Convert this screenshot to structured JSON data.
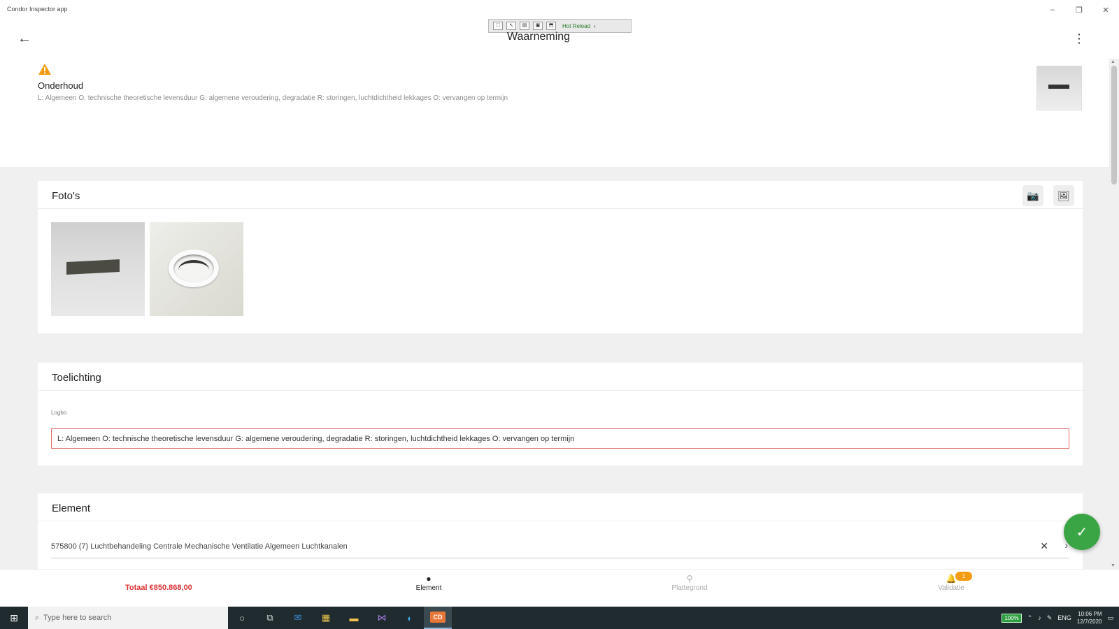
{
  "window": {
    "title": "Condor Inspector app",
    "controls": {
      "minimize": "–",
      "maximize": "❐",
      "close": "✕"
    }
  },
  "debug_toolbar": {
    "hot_reload": "Hot Reload"
  },
  "header": {
    "title": "Waarneming",
    "back_icon": "arrow-left-icon",
    "more_icon": "more-vertical-icon"
  },
  "summary": {
    "title": "Onderhoud",
    "description": "L: Algemeen O: technische theoretische levensduur G: algemene veroudering, degradatie R: storingen, luchtdichtheid lekkages O: vervangen op termijn",
    "warning_color": "#f39c12"
  },
  "photos": {
    "title": "Foto's",
    "camera_icon": "camera-icon",
    "gallery_icon": "image-gallery-icon"
  },
  "toelichting": {
    "title": "Toelichting",
    "field_label": "Logbo",
    "value": "L: Algemeen O: technische theoretische levensduur G: algemene veroudering, degradatie R: storingen, luchtdichtheid lekkages O: vervangen op termijn"
  },
  "element": {
    "title": "Element",
    "value": "575800 (7) Luchtbehandeling Centrale Mechanische Ventilatie Algemeen Luchtkanalen"
  },
  "fab": {
    "icon": "check-icon",
    "color": "#3aa544"
  },
  "bottom_nav": {
    "total": "Totaal €850.868,00",
    "items": [
      {
        "label": "Element",
        "icon": "info-icon"
      },
      {
        "label": "Plattegrond",
        "icon": "map-pin-icon"
      },
      {
        "label": "Validatie",
        "icon": "bell-icon",
        "badge": "1"
      }
    ]
  },
  "taskbar": {
    "search_placeholder": "Type here to search",
    "battery": "100%",
    "language": "ENG",
    "time": "10:06 PM",
    "date": "12/7/2020"
  }
}
